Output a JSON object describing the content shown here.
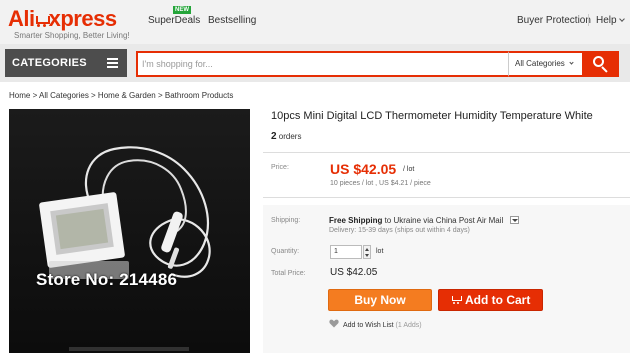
{
  "header": {
    "logo_ali": "Ali",
    "logo_express": "xpress",
    "tagline": "Smarter Shopping, Better Living!",
    "nav": [
      {
        "label": "SuperDeals",
        "badge": "NEW"
      },
      {
        "label": "Bestselling"
      }
    ],
    "buyer_protection": "Buyer Protection",
    "help": "Help"
  },
  "search": {
    "categories_label": "CATEGORIES",
    "placeholder": "I'm shopping for...",
    "category_select": "All Categories"
  },
  "breadcrumb": "Home > All Categories > Home & Garden > Bathroom Products",
  "product": {
    "watermark": "Store No: 214486",
    "title": "10pcs Mini Digital LCD Thermometer Humidity Temperature White",
    "orders_count": "2",
    "orders_label": "orders",
    "price_label": "Price:",
    "price": "US $42.05",
    "price_unit": "/ lot",
    "price_detail": "10 pieces / lot , US $4.21 / piece",
    "shipping_label": "Shipping:",
    "shipping_method": "Free Shipping",
    "shipping_dest": "to Ukraine via China Post Air Mail",
    "delivery": "Delivery: 15-39 days (ships out within 4 days)",
    "quantity_label": "Quantity:",
    "quantity": "1",
    "quantity_unit": "lot",
    "total_label": "Total Price:",
    "total_price": "US $42.05",
    "buy_now": "Buy Now",
    "add_to_cart": "Add to Cart",
    "wishlist": "Add to Wish List",
    "wishlist_count": "(1 Adds)"
  },
  "colors": {
    "brand": "#e62e04",
    "buy_now": "#f47c20",
    "new_badge": "#25a53a"
  }
}
